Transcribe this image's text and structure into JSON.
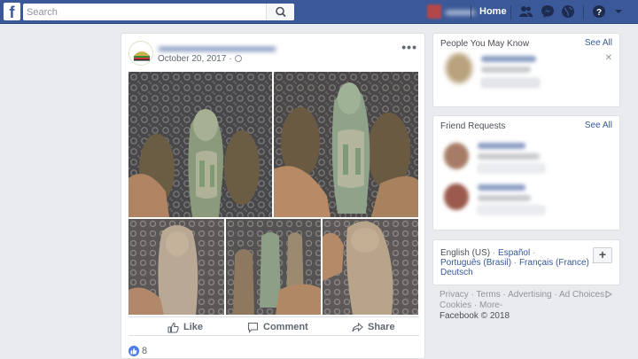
{
  "topbar": {
    "logo_letter": "f",
    "search_placeholder": "Search",
    "home_label": "Home",
    "brand_color": "#3b5998"
  },
  "post": {
    "date": "October 20, 2017",
    "date_separator": "·",
    "menu_glyph": "•••",
    "actions": {
      "like": "Like",
      "comment": "Comment",
      "share": "Share"
    },
    "like_count": "8"
  },
  "sidebar": {
    "pymk": {
      "title": "People You May Know",
      "see_all": "See All",
      "close_glyph": "✕"
    },
    "friend_requests": {
      "title": "Friend Requests",
      "see_all": "See All"
    },
    "languages": {
      "current": "English (US)",
      "items": [
        "Español",
        "Português (Brasil)",
        "Français (France)",
        "Deutsch"
      ],
      "separator": "·",
      "add_glyph": "+"
    },
    "footer": {
      "links": [
        "Privacy",
        "Terms",
        "Advertising",
        "Ad Choices",
        "Cookies",
        "More"
      ],
      "separator": "·",
      "more_suffix": "-",
      "copyright": "Facebook © 2018"
    }
  }
}
